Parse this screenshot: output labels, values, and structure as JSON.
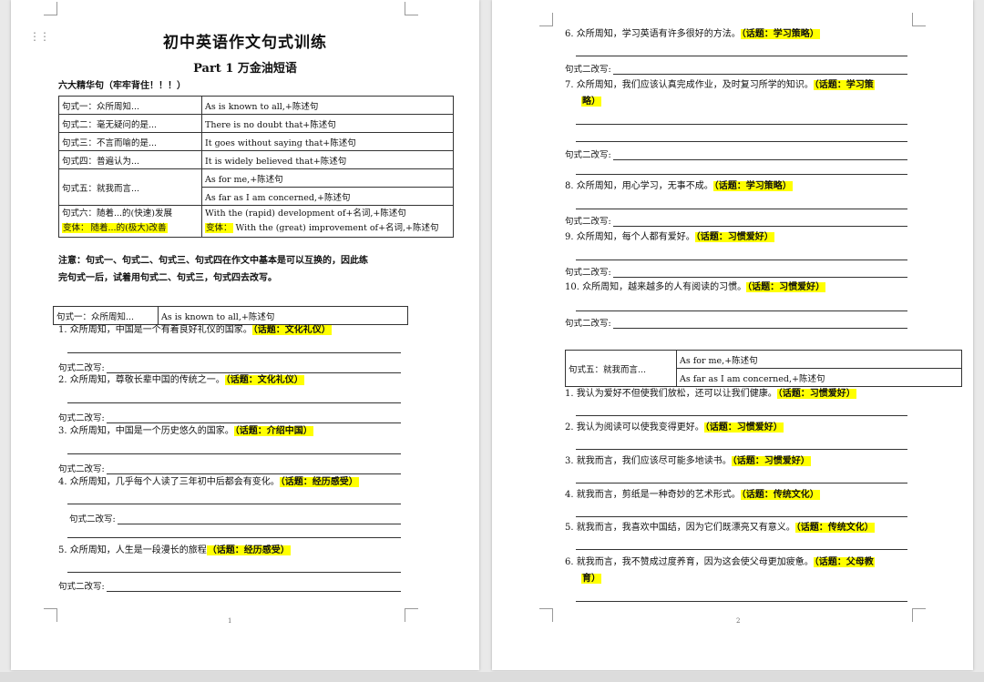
{
  "page1": {
    "title": "初中英语作文句式训练",
    "subtitle": "Part 1  万金油短语",
    "six_heading": "六大精华句（牢牢背住！！！）",
    "table": [
      {
        "label": "句式一：众所周知...",
        "values": [
          "As is known to all,+陈述句"
        ]
      },
      {
        "label": "句式二：毫无疑问的是...",
        "values": [
          "There is no doubt that+陈述句"
        ]
      },
      {
        "label": "句式三：不言而喻的是...",
        "values": [
          "It goes without saying that+陈述句"
        ]
      },
      {
        "label": "句式四：普遍认为...",
        "values": [
          "It is widely believed that+陈述句"
        ]
      },
      {
        "label": "句式五：就我而言...",
        "values": [
          "As for me,+陈述句",
          "As far as I am concerned,+陈述句"
        ]
      },
      {
        "label": "句式六：随着...的(快速)发展",
        "label_variant_prefix": "变体：",
        "label_variant_rest": "随着...的(极大)改善",
        "values": [
          "With the (rapid) development of+名词,+陈述句"
        ],
        "variant_prefix": "变体：",
        "variant_rest": " With the (great) improvement of+名词,+陈述句"
      }
    ],
    "note_line1": "注意：句式一、句式二、句式三、句式四在作文中基本是可以互换的，因此练",
    "note_line2": "完句式一后，试着用句式二、句式三，句式四去改写。",
    "pattern_box": {
      "label": "句式一：众所周知...",
      "value": "As is known to all,+陈述句"
    },
    "rewrite_label": "句式二改写:",
    "items": [
      {
        "text": "1. 众所周知，中国是一个有着良好礼仪的国家。",
        "topic": "（话题：文化礼仪）"
      },
      {
        "text": "2. 众所周知，尊敬长辈中国的传统之一。",
        "topic": "（话题：文化礼仪）"
      },
      {
        "text": "3. 众所周知，中国是一个历史悠久的国家。",
        "topic": "（话题：介绍中国）"
      },
      {
        "text": "4. 众所周知，几乎每个人读了三年初中后都会有变化。",
        "topic": "（话题：经历感受）"
      },
      {
        "text": "5. 众所周知，人生是一段漫长的旅程",
        "topic": "（话题：经历感受）"
      }
    ],
    "page_number": "1"
  },
  "page2": {
    "rewrite_label": "句式二改写:",
    "items_a": [
      {
        "text": "6. 众所周知，学习英语有许多很好的方法。",
        "topic": "（话题：学习策略）"
      },
      {
        "text": "7. 众所周知，我们应该认真完成作业，及时复习所学的知识。",
        "topic": "（话题：学习策",
        "topic_cont": "略）"
      },
      {
        "text": "8. 众所周知，用心学习，无事不成。",
        "topic": "（话题：学习策略）"
      },
      {
        "text": "9. 众所周知，每个人都有爱好。",
        "topic": "（话题：习惯爱好）"
      },
      {
        "text": "10. 众所周知，越来越多的人有阅读的习惯。",
        "topic": "（话题：习惯爱好）"
      }
    ],
    "pattern_box": {
      "label": "句式五：就我而言...",
      "values": [
        "As for me,+陈述句",
        "As far as I am concerned,+陈述句"
      ]
    },
    "items_b": [
      {
        "text": "1. 我认为爱好不但使我们放松，还可以让我们健康。",
        "topic": "（话题：习惯爱好）"
      },
      {
        "text": "2. 我认为阅读可以使我变得更好。",
        "topic": "（话题：习惯爱好）"
      },
      {
        "text": "3. 就我而言，我们应该尽可能多地读书。",
        "topic": "（话题：习惯爱好）"
      },
      {
        "text": "4. 就我而言，剪纸是一种奇妙的艺术形式。",
        "topic": "（话题：传统文化）"
      },
      {
        "text": "5. 就我而言，我喜欢中国结，因为它们既漂亮又有意义。",
        "topic": "（话题：传统文化）"
      },
      {
        "text": "6. 就我而言，我不赞成过度养育，因为这会使父母更加疲惫。",
        "topic": "（话题：父母教",
        "topic_cont": "育）"
      }
    ],
    "page_number": "2"
  }
}
